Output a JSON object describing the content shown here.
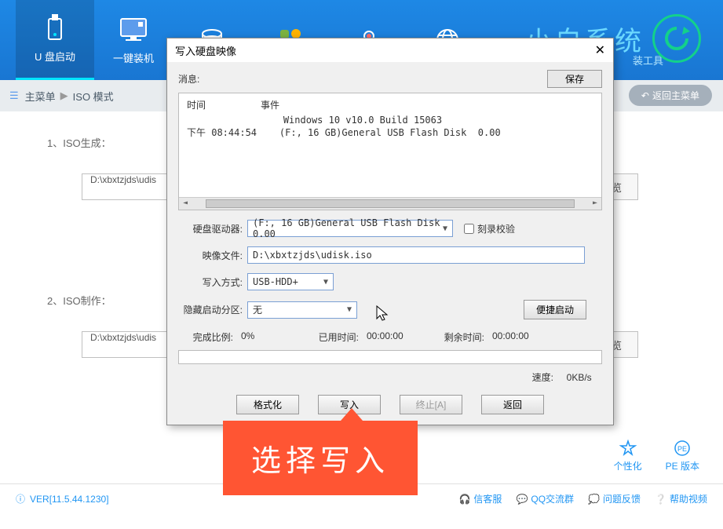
{
  "header": {
    "tabs": [
      {
        "label": "U 盘启动",
        "icon": "usb"
      },
      {
        "label": "一键装机",
        "icon": "monitor"
      },
      {
        "label": "",
        "icon": "database"
      },
      {
        "label": "",
        "icon": "apps"
      },
      {
        "label": "",
        "icon": "user"
      },
      {
        "label": "",
        "icon": "globe"
      }
    ],
    "brand": "小白系统",
    "tool_text": "装工具"
  },
  "breadcrumb": {
    "root": "主菜单",
    "current": "ISO 模式",
    "back_label": "返回主菜单"
  },
  "main": {
    "step1_label": "1、ISO生成：",
    "step2_label": "2、ISO制作：",
    "path1": "D:\\xbxtzjds\\udis",
    "path2": "D:\\xbxtzjds\\udis",
    "browse_label": "浏览"
  },
  "right": {
    "item1": "个性化",
    "item2": "PE 版本"
  },
  "bottom": {
    "version": "VER[11.5.44.1230]",
    "links": [
      "信客服",
      "QQ交流群",
      "问题反馈",
      "帮助视频"
    ]
  },
  "dialog": {
    "title": "写入硬盘映像",
    "message_label": "消息:",
    "save_label": "保存",
    "log": {
      "col1": "时间",
      "col2": "事件",
      "line1": "                 Windows 10 v10.0 Build 15063",
      "line2": "下午 08:44:54    (F:, 16 GB)General USB Flash Disk  0.00"
    },
    "disk_drive_label": "硬盘驱动器:",
    "disk_drive_value": "(F:, 16 GB)General USB Flash Disk  0.00",
    "verify_label": "刻录校验",
    "image_file_label": "映像文件:",
    "image_file_value": "D:\\xbxtzjds\\udisk.iso",
    "write_mode_label": "写入方式:",
    "write_mode_value": "USB-HDD+",
    "hide_boot_label": "隐藏启动分区:",
    "hide_boot_value": "无",
    "quick_boot": "便捷启动",
    "progress_label": "完成比例:",
    "progress_value": "0%",
    "elapsed_label": "已用时间:",
    "elapsed_value": "00:00:00",
    "remaining_label": "剩余时间:",
    "remaining_value": "00:00:00",
    "speed_label": "速度:",
    "speed_value": "0KB/s",
    "buttons": {
      "format": "格式化",
      "write": "写入",
      "stop": "终止[A]",
      "back": "返回"
    }
  },
  "callout": "选择写入"
}
